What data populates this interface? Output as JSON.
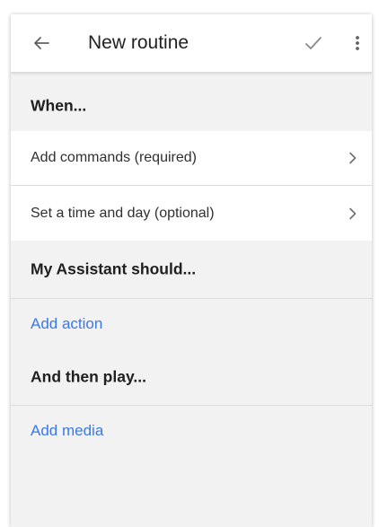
{
  "header": {
    "title": "New routine",
    "back_icon": "arrow-left-icon",
    "save_icon": "check-icon",
    "menu_icon": "more-vert-icon"
  },
  "sections": {
    "when_heading": "When...",
    "add_commands": "Add commands (required)",
    "set_time": "Set a time and day (optional)",
    "assistant_heading": "My Assistant should...",
    "add_action": "Add action",
    "then_play_heading": "And then play...",
    "add_media": "Add media"
  },
  "colors": {
    "link": "#3b78e7",
    "background": "#f2f2f2",
    "surface": "#ffffff"
  }
}
